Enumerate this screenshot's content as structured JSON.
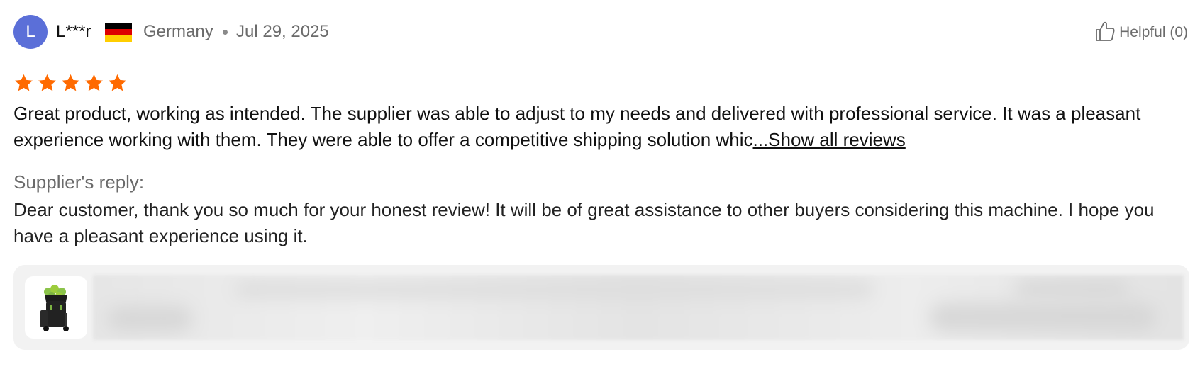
{
  "review": {
    "user": {
      "initial": "L",
      "avatar_color": "#5b6fd8",
      "name": "L***r",
      "flag_icon": "germany-flag-icon",
      "flag_colors": [
        "#000000",
        "#dd0000",
        "#ffce00"
      ],
      "country": "Germany",
      "date": "Jul 29, 2025"
    },
    "helpful": {
      "icon": "thumbs-up-icon",
      "label": "Helpful (0)"
    },
    "rating": {
      "stars": 5,
      "max": 5,
      "color": "#ff6a00"
    },
    "text": "Great product, working as intended. The supplier was able to adjust to my needs and delivered with professional service. It was a pleasant experience working with them. They were able to offer a competitive shipping solution whic",
    "show_all_label": "...Show all reviews",
    "supplier_reply": {
      "label": "Supplier's reply:",
      "text": "Dear customer, thank you so much for your honest review! It will be of great assistance to other buyers considering this machine. I hope you have a pleasant experience using it."
    },
    "product": {
      "thumbnail_icon": "tennis-ball-machine-thumbnail",
      "card_background": "#f2f2f2"
    }
  }
}
